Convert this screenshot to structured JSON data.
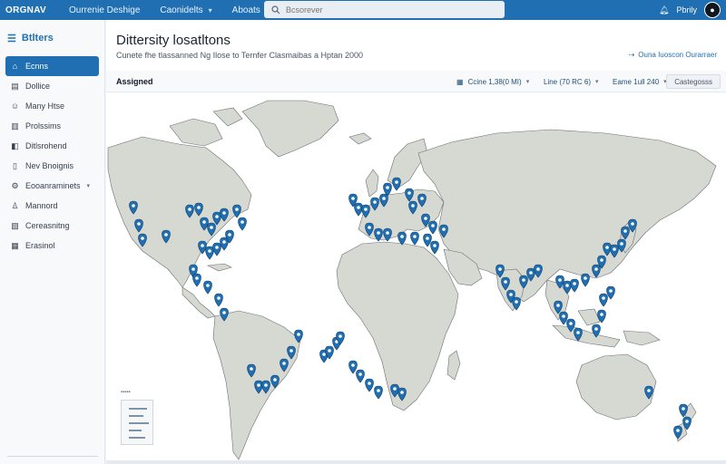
{
  "topbar": {
    "logo": "ORGNAV",
    "nav": [
      {
        "label": "Ourrenie Deshige",
        "has_menu": false
      },
      {
        "label": "Caonidelts",
        "has_menu": true
      },
      {
        "label": "Aboats",
        "has_menu": false
      }
    ],
    "search_placeholder": "Bcsorever",
    "user_label": "Pbrily"
  },
  "sidebar": {
    "title": "Btlters",
    "items": [
      {
        "label": "Ecnns",
        "icon": "home-icon",
        "active": true
      },
      {
        "label": "Dollice",
        "icon": "document-icon",
        "active": false
      },
      {
        "label": "Many Htse",
        "icon": "people-icon",
        "active": false
      },
      {
        "label": "Prolssims",
        "icon": "folder-icon",
        "active": false
      },
      {
        "label": "Ditlsrohend",
        "icon": "tag-icon",
        "active": false
      },
      {
        "label": "Nev Bnoignis",
        "icon": "bookmark-icon",
        "active": false
      },
      {
        "label": "Eooanraminets",
        "icon": "cog-icon",
        "active": false,
        "has_menu": true
      },
      {
        "label": "Mannord",
        "icon": "user-icon",
        "active": false
      },
      {
        "label": "Cereasnitng",
        "icon": "chart-icon",
        "active": false
      },
      {
        "label": "Erasinol",
        "icon": "grid-icon",
        "active": false
      }
    ]
  },
  "main": {
    "title": "Dittersity losatltons",
    "subtitle": "Cunete fhe tlassanned Ng Ilose to Ternfer Clasmaibas a Hptan 2000",
    "help_link": "Ouna Iuoscon Ourarraer",
    "toolbar": {
      "section": "Assigned",
      "control1": "Ccine 1,38(0 MI)",
      "control2": "Line (70 RC 6)",
      "control3": "Eame 1ull 240",
      "button": "Castegosss"
    }
  },
  "colors": {
    "brand": "#1f6fb2",
    "land": "#d6d8d2",
    "pin": "#1f6fb2"
  }
}
